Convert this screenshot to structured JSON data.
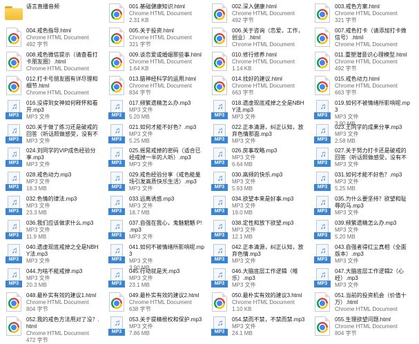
{
  "files": [
    {
      "name": "语言直播音频",
      "type": "",
      "size": "",
      "kind": "folder"
    },
    {
      "name": "001.基础健康知识.html",
      "type": "Chrome HTML Document",
      "size": "2.31 KB",
      "kind": "html"
    },
    {
      "name": "002.深入健康.html",
      "type": "Chrome HTML Document",
      "size": "492 字节",
      "kind": "html"
    },
    {
      "name": "003.戒色方案.html",
      "type": "Chrome HTML Document",
      "size": "321 字节",
      "kind": "html"
    },
    {
      "name": "004.戒色指导.html",
      "type": "Chrome HTML Document",
      "size": "492 字节",
      "kind": "html"
    },
    {
      "name": "005.关于投资.html",
      "type": "Chrome HTML Document",
      "size": "321 字节",
      "kind": "html"
    },
    {
      "name": "006.关于咨询（恋爱，工作，创业）.html",
      "type": "Chrome HTML Document",
      "size": "",
      "kind": "html"
    },
    {
      "name": "007.戒色打卡（请添加打卡微信号）.html",
      "type": "Chrome HTML Document",
      "size": "",
      "kind": "html"
    },
    {
      "name": "008.戒色微信提示（请查看打卡朋友圈）.html",
      "type": "Chrome HTML Document",
      "size": "",
      "kind": "html"
    },
    {
      "name": "009.谈恋爱或婚姻那些事.html",
      "type": "Chrome HTML Document",
      "size": "1.64 KB",
      "kind": "html"
    },
    {
      "name": "010.修行修养.html",
      "type": "Chrome HTML Document",
      "size": "1.14 KB",
      "kind": "html"
    },
    {
      "name": "011.重塑潜意识心理模型.html",
      "type": "Chrome HTML Document",
      "size": "492 字节",
      "kind": "html"
    },
    {
      "name": "012.打卡号朋友圈有详尽理和细节.html",
      "type": "Chrome HTML Document",
      "size": "",
      "kind": "html"
    },
    {
      "name": "013.脑神经科学的运用.html",
      "type": "Chrome HTML Document",
      "size": "834 字节",
      "kind": "html"
    },
    {
      "name": "014.找好的建议.html",
      "type": "Chrome HTML Document",
      "size": "663 字节",
      "kind": "html"
    },
    {
      "name": "015.戒色动力.html",
      "type": "Chrome HTML Document",
      "size": "663 字节",
      "kind": "html"
    },
    {
      "name": "016.没得到女神如何释怀和看开.mp3",
      "type": "MP3 文件",
      "size": "",
      "kind": "mp3"
    },
    {
      "name": "017.频繁遗精怎么办.mp3",
      "type": "MP3 文件",
      "size": "5.20 MB",
      "kind": "mp3"
    },
    {
      "name": "018.遗虚现底戒掉之全是NBHY法.mp3",
      "type": "MP3 文件",
      "size": "",
      "kind": "mp3"
    },
    {
      "name": "019.如何不被情绪所影响呢.mp3",
      "type": "MP3 文件",
      "size": "3.90 MB",
      "kind": "mp3"
    },
    {
      "name": "020.关于做了练习还是破戒的回答（听话照做感受，没有不成功的...",
      "type": "MP3 文件",
      "size": "",
      "kind": "mp3"
    },
    {
      "name": "021.如何才能不好色？.mp3",
      "type": "MP3 文件",
      "size": "5.25 MB",
      "kind": "mp3"
    },
    {
      "name": "022.正本清源，纠正认知，放弃色情那面.mp3",
      "type": "MP3 文件",
      "size": "",
      "kind": "mp3"
    },
    {
      "name": "023.王同学的成果分享.mp3",
      "type": "MP3 文件",
      "size": "2.58 MB",
      "kind": "mp3"
    },
    {
      "name": "024.刘同学的VIP成色经验分享.mp3",
      "type": "MP3 文件",
      "size": "",
      "kind": "mp3"
    },
    {
      "name": "025.摇晃戒掉的密码（适合已经戒掉一半的人听）.mp3",
      "type": "MP3 文件",
      "size": "",
      "kind": "mp3"
    },
    {
      "name": "026.房事攻略.mp3",
      "type": "MP3 文件",
      "size": "6.64 MB",
      "kind": "mp3"
    },
    {
      "name": "027.关于努力打卡还是破戒的回答（听话照做感受，没有不成功的...",
      "type": "MP3 文件",
      "size": "",
      "kind": "mp3"
    },
    {
      "name": "028.戒色动力.mp3",
      "type": "MP3 文件",
      "size": "18.3 MB",
      "kind": "mp3"
    },
    {
      "name": "029.戒色经验分享（戒色能量场引发高质快乐生活）.mp3",
      "type": "MP3 文件",
      "size": "",
      "kind": "mp3"
    },
    {
      "name": "030.高频的快乐.mp3",
      "type": "MP3 文件",
      "size": "5.93 MB",
      "kind": "mp3"
    },
    {
      "name": "031.如何才能不好色？.mp3",
      "type": "MP3 文件",
      "size": "5.25 MB",
      "kind": "mp3"
    },
    {
      "name": "032.色情的律法.mp3",
      "type": "MP3 文件",
      "size": "23.3 MB",
      "kind": "mp3"
    },
    {
      "name": "033.远离诱惑.mp3",
      "type": "MP3 文件",
      "size": "18.7 MB",
      "kind": "mp3"
    },
    {
      "name": "034.欲望本来是好事.mp3",
      "type": "MP3 文件",
      "size": "19.0 MB",
      "kind": "mp3"
    },
    {
      "name": "035.为什么要坚持？欲望和耻辱的马.mp3",
      "type": "MP3 文件",
      "size": "",
      "kind": "mp3"
    },
    {
      "name": "036.我们应该做求什么.mp3",
      "type": "MP3 文件",
      "size": "11.9 MB",
      "kind": "mp3"
    },
    {
      "name": "037.自强在我心，鬼魅魍魉 P! .mp3",
      "type": "MP3 文件",
      "size": "",
      "kind": "mp3"
    },
    {
      "name": "038.定性和放下欲望.mp3",
      "type": "MP3 文件",
      "size": "12.1 MB",
      "kind": "mp3"
    },
    {
      "name": "039.频繁遗精怎么办.mp3",
      "type": "MP3 文件",
      "size": "5.20 MB",
      "kind": "mp3"
    },
    {
      "name": "040.遗虚现底戒掉之全是NBHY法.mp3",
      "type": "MP3 文件",
      "size": "",
      "kind": "mp3"
    },
    {
      "name": "041.如何不被情绪所影响呢.mp3",
      "type": "MP3 文件",
      "size": "3.90 MB",
      "kind": "mp3"
    },
    {
      "name": "042.正本清源，纠正认知，放弃色情.mp3",
      "type": "MP3 文件",
      "size": "",
      "kind": "mp3"
    },
    {
      "name": "043.自强者得红尘真相（全面版本）.mp3",
      "type": "MP3 文件",
      "size": "",
      "kind": "mp3"
    },
    {
      "name": "044.为啥不能戒掉.mp3",
      "type": "MP3 文件",
      "size": "20.3 MB",
      "kind": "mp3"
    },
    {
      "name": "045.行动就是天.mp3",
      "type": "MP3 文件",
      "size": "23.1 MB",
      "kind": "mp3"
    },
    {
      "name": "046.大脑底层工作逻辑（唯乐）.mp3",
      "type": "MP3 文件",
      "size": "",
      "kind": "mp3"
    },
    {
      "name": "047.大脑底层工作逻辑2（心经）.mp3",
      "type": "MP3 文件",
      "size": "",
      "kind": "mp3"
    },
    {
      "name": "048.最朴实有效的建议1.html",
      "type": "Chrome HTML Document",
      "size": "804 字节",
      "kind": "html"
    },
    {
      "name": "049.最朴实有效的建议2.html",
      "type": "Chrome HTML Document",
      "size": "638 字节",
      "kind": "html"
    },
    {
      "name": "050.最朴实有效的建议3.html",
      "type": "Chrome HTML Document",
      "size": "1.10 KB",
      "kind": "html"
    },
    {
      "name": "051.当前的投资机会（价值十万）.html",
      "type": "Chrome HTML Document",
      "size": "",
      "kind": "html"
    },
    {
      "name": "052.我的戒色方法用对了没？.html",
      "type": "Chrome HTML Document",
      "size": "472 字节",
      "kind": "html"
    },
    {
      "name": "053.关于提精根权和保护.mp3",
      "type": "MP3 文件",
      "size": "7.86 MB",
      "kind": "mp3"
    },
    {
      "name": "054.禁而不禁，不禁而禁.mp3",
      "type": "MP3 文件",
      "size": "24.1 MB",
      "kind": "mp3"
    },
    {
      "name": "055.生理欲望问题.html",
      "type": "Chrome HTML Document",
      "size": "804 字节",
      "kind": "html"
    }
  ]
}
